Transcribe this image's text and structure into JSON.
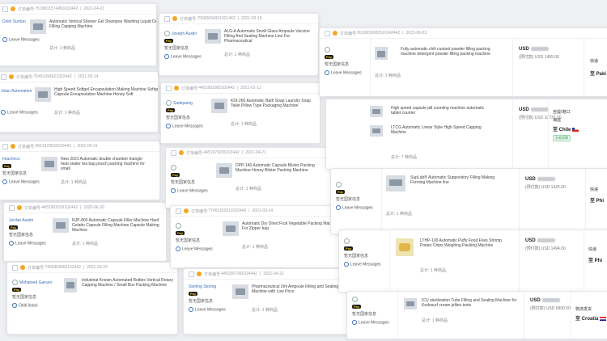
{
  "labels": {
    "order_no": "订单编号:",
    "separator": "|",
    "pay_badge": "Pay",
    "nation_hidden": "暂无国家信息",
    "leave_messages": "Leave Messages",
    "qty": "总计: 1 种商品",
    "qty_7": "总计: 7 种商品",
    "currency": "USD",
    "ship_express": "快递",
    "ship_own": "自提/港口",
    "ship_sea": "海运",
    "ship_local": "物流发货",
    "badge_trade": "交易保障"
  },
  "cards": [
    {
      "id": "c1",
      "order": "7518001574450102442",
      "date": "2021-04-21",
      "buyer": "Dolin Suntan",
      "product": "Automatic Vertical Shower Gel Shampoo Washing Liquid Detergent Filling Capping Machine",
      "qty": "总计: 1 种商品"
    },
    {
      "id": "c2",
      "order": "75582004951021462",
      "date": "2021-03-15",
      "buyer": "Joseph Austin",
      "product": "ALG-A Automatic Small Glass Ampoule Vaccine Filling And Sealing Machine Line For Pharmaceutical",
      "qty": "总计: 1 种商品"
    },
    {
      "id": "c3",
      "order": "5519030000510142442",
      "date": "2023-09-23",
      "buyer": "",
      "product": "Fully automatic chili custard powder filling packing machine detergent powder filling packing machine",
      "qty": "总计: 1 种商品",
      "price_sub": "(预付款) USD 1455.00",
      "ship": "快递",
      "dest": "至 Paki"
    },
    {
      "id": "c4",
      "order": "75451994921022442",
      "date": "2021-05-14",
      "buyer": "Jolan Automation",
      "product": "High Speed Softgel Encapsulation Making Machine Softgel Capsule Encapsulation Machine Honey Soft",
      "qty": "总计: 1 种商品"
    },
    {
      "id": "c5",
      "order": "4451992905102442",
      "date": "2021-01-12",
      "buyer": "Sadiqueng",
      "product": "KDI-260 Automatic Bath Soap Laundry Soap Toilet Pillow Type Packaging Machine",
      "qty": "总计: 1 种商品"
    },
    {
      "id": "c6",
      "order": "",
      "date": "",
      "buyer": "",
      "product": "High speed capsule pill counting machine automatic tablet counter",
      "product2": "LTCG Automatic Linear Style High Speed Capping Machine",
      "qty": "总计: 7 种商品",
      "price_sub": "(预付款) USD 10737.00",
      "ship": "自提/港口",
      "ship2": "海运",
      "dest": "至 Chile",
      "badge": "交易保障"
    },
    {
      "id": "c7",
      "order": "4551970515010442",
      "date": "2021-04-21",
      "buyer": "Intachrico",
      "product": "New 2021 Automatic double chamber triangle heat sealer tea bag pouch packing machine for small",
      "qty": "总计: 1 种商品"
    },
    {
      "id": "c8",
      "order": "4451979205102442",
      "date": "2021-04-21",
      "buyer": "",
      "product": "DPP-140 Automatic Capsule Blister Packing Machine Honey Blister Packing Machine",
      "qty": "总计: 1 种商品"
    },
    {
      "id": "c9",
      "order": "",
      "date": "",
      "buyer": "",
      "product": "SupLab® Automatic Suppository Filling Making Forming Machine line",
      "qty": "总计: 1 种商品",
      "price_sub": "(预付款) USD 1425.00",
      "ship": "快递",
      "dest": "至 Phi"
    },
    {
      "id": "c10",
      "order": "4452902019102442",
      "date": "2020-06-30",
      "buyer": "Jordan Austin",
      "product": "NJP-800 Automatic Capsule Filler Machine Hard Gelatin Capsule Filling Machine Capsule Making Machine",
      "qty": "总计: 1 种商品"
    },
    {
      "id": "c11",
      "order": "77491152010102442",
      "date": "2021-03-14",
      "buyer": "",
      "product": "Automatic Dry Dried Fruit Vegetable Packing Machine For Zipper bag",
      "qty": "总计: 1 种商品"
    },
    {
      "id": "c12",
      "order": "",
      "date": "",
      "buyer": "",
      "product": "LTHP-100 Automatic Puffy Food Fries Shrimp Potato Chips Weighing Packing Machine",
      "qty": "总计: 1 种商品",
      "price_sub": "(预付款) USD 1494.00",
      "ship": "快递",
      "dest": "至 Phi"
    },
    {
      "id": "c13",
      "order": "7495404965102442",
      "date": "2021-03-23",
      "buyer": "Mohamed Ganaro",
      "product": "Industrial Known Automated Bottles Vertical Rotary Capping Machine / Small Box Packing Machine",
      "qty": "Obiti Ilstari"
    },
    {
      "id": "c14",
      "order": "4452367091024442",
      "date": "2021-04-21",
      "buyer": "Sterling Storing",
      "product": "Pharmaceutical 2ml Ampoule Filling and Sealing Machine with Low Price",
      "qty": "总计: 1 种商品"
    },
    {
      "id": "c15",
      "order": "",
      "date": "",
      "buyer": "",
      "product": "ICU sterilization Tube Filling and Sealing Machine for Kodosurf cream jellies tests",
      "qty": "总计: 1 种商品",
      "price_sub": "(预付款) USD 5890.00",
      "ship": "物流发货",
      "dest": "至 Croatia"
    }
  ],
  "colors": {
    "accent": "#3b6fb6",
    "pay_bg": "#1a1a1a",
    "pay_fg": "#f5c518",
    "order_dot": "#f5a623"
  }
}
